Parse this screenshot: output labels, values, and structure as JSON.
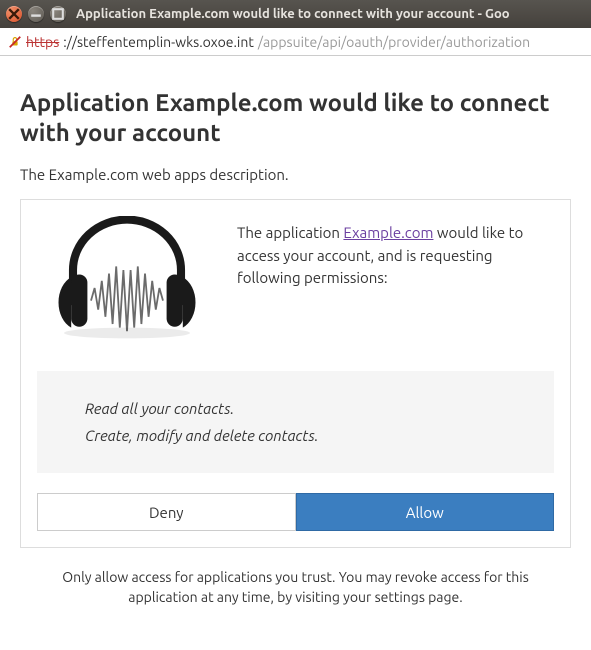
{
  "window": {
    "title": "Application Example.com would like to connect with your account - Goo"
  },
  "address": {
    "scheme_strike": "https",
    "host": "://steffentemplin-wks.oxoe.int",
    "path": "/appsuite/api/oauth/provider/authorization"
  },
  "page": {
    "heading": "Application Example.com would like to connect with your account",
    "description": "The Example.com web apps description."
  },
  "consent": {
    "intro_pre": "The application ",
    "app_link": "Example.com",
    "intro_post": " would like to access your account, and is requesting following permissions:",
    "permissions": [
      "Read all your contacts.",
      "Create, modify and delete contacts."
    ],
    "deny_label": "Deny",
    "allow_label": "Allow"
  },
  "footer": "Only allow access for applications you trust. You may revoke access for this application at any time, by visiting your settings page."
}
